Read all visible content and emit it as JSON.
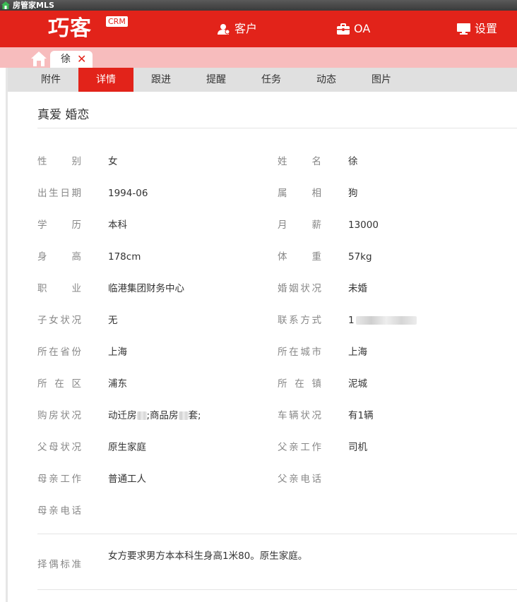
{
  "window": {
    "title": "房管家MLS"
  },
  "header": {
    "logo": "巧客",
    "badge": "CRM",
    "nav": [
      {
        "label": "客户",
        "icon": "user-icon"
      },
      {
        "label": "OA",
        "icon": "briefcase-icon"
      },
      {
        "label": "设置",
        "icon": "monitor-icon"
      }
    ]
  },
  "tabs": {
    "open_tab": "徐",
    "close": "✕"
  },
  "subtabs": [
    "附件",
    "详情",
    "跟进",
    "提醒",
    "任务",
    "动态",
    "图片"
  ],
  "active_subtab": "详情",
  "profile": {
    "heading": "真爱 婚恋",
    "fields": [
      [
        {
          "label": "性别",
          "value": "女"
        },
        {
          "label": "姓名",
          "value": "徐"
        }
      ],
      [
        {
          "label": "出生日期",
          "value": "1994-06"
        },
        {
          "label": "属相",
          "value": "狗"
        }
      ],
      [
        {
          "label": "学历",
          "value": "本科"
        },
        {
          "label": "月薪",
          "value": "13000"
        }
      ],
      [
        {
          "label": "身高",
          "value": "178cm"
        },
        {
          "label": "体重",
          "value": "57kg"
        }
      ],
      [
        {
          "label": "职业",
          "value": "临港集团财务中心"
        },
        {
          "label": "婚姻状况",
          "value": "未婚"
        }
      ],
      [
        {
          "label": "子女状况",
          "value": "无"
        },
        {
          "label": "联系方式",
          "value": "1"
        }
      ],
      [
        {
          "label": "所在省份",
          "value": "上海"
        },
        {
          "label": "所在城市",
          "value": "上海"
        }
      ],
      [
        {
          "label": "所在区",
          "value": "浦东"
        },
        {
          "label": "所在镇",
          "value": "泥城"
        }
      ],
      [
        {
          "label": "购房状况",
          "value_parts": [
            "动迁房",
            ";商品房",
            "套;"
          ]
        },
        {
          "label": "车辆状况",
          "value": "有1辆"
        }
      ],
      [
        {
          "label": "父母状况",
          "value": "原生家庭"
        },
        {
          "label": "父亲工作",
          "value": "司机"
        }
      ],
      [
        {
          "label": "母亲工作",
          "value": "普通工人"
        },
        {
          "label": "父亲电话",
          "value": ""
        }
      ],
      [
        {
          "label": "母亲电话",
          "value": ""
        }
      ]
    ],
    "criteria": {
      "label": "择偶标准",
      "value": "女方要求男方本本科生身高1米80。原生家庭。"
    }
  },
  "colors": {
    "brand_red": "#e2231a",
    "tab_strip_pink": "#f7bcbd",
    "label_gray": "#888888"
  }
}
